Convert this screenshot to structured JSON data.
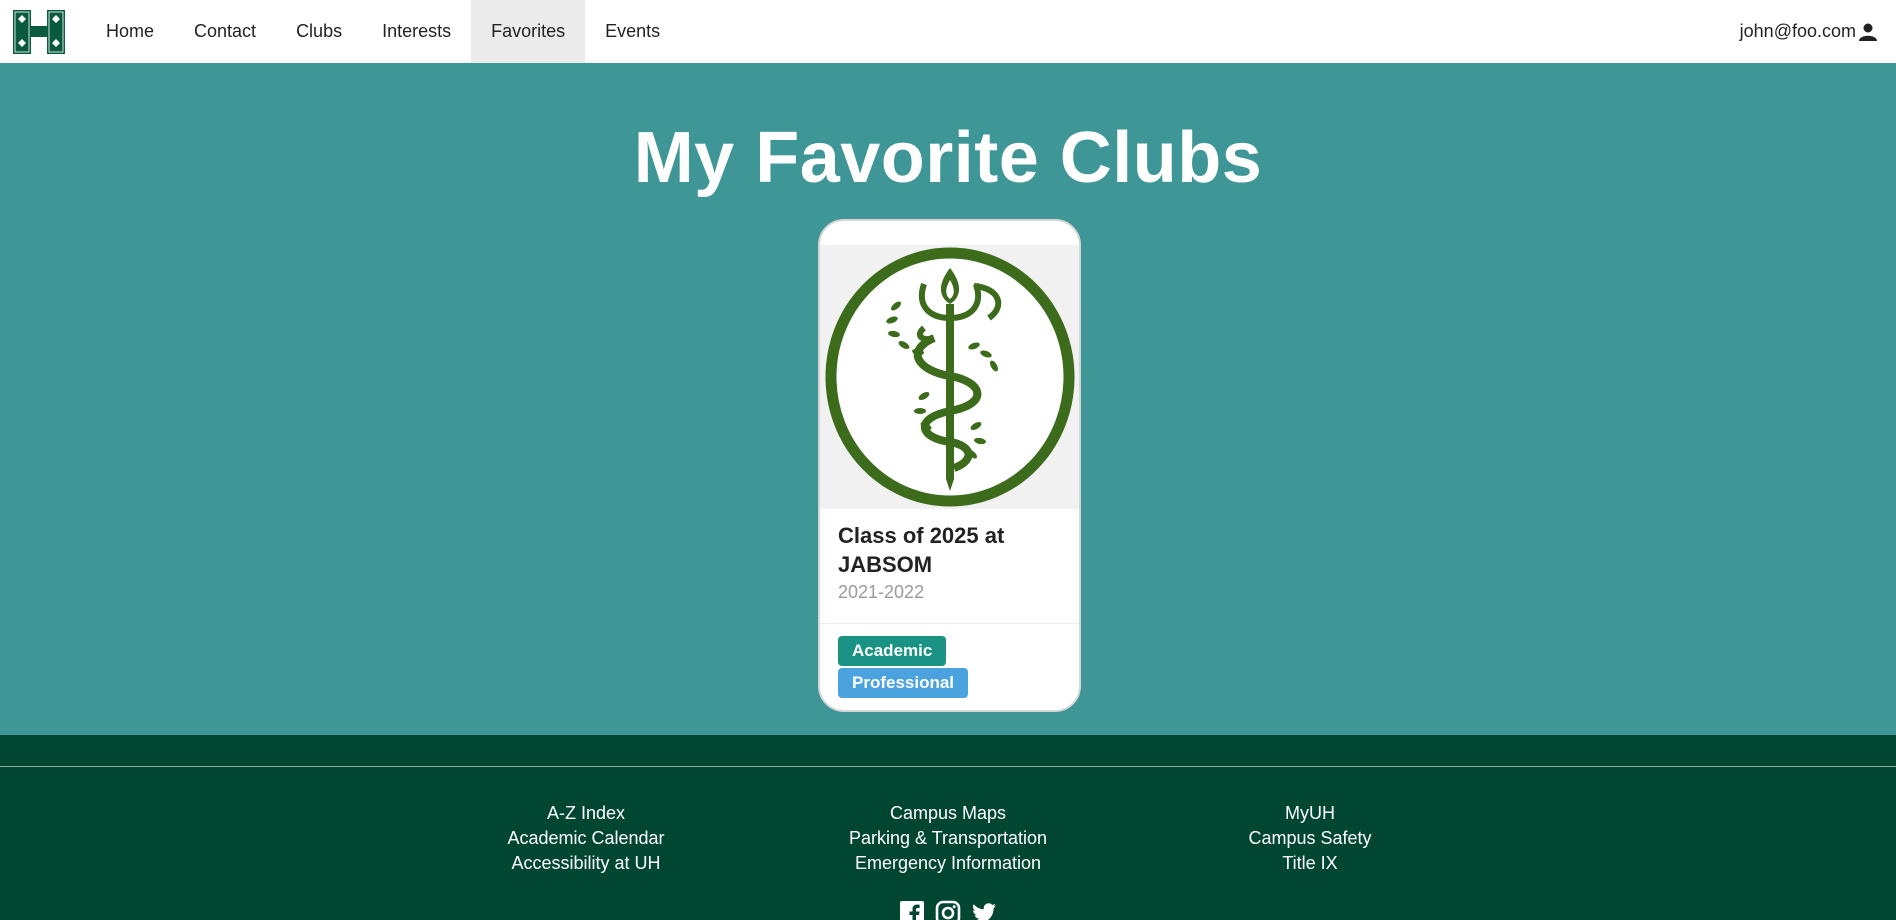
{
  "nav": {
    "items": [
      {
        "label": "Home"
      },
      {
        "label": "Contact"
      },
      {
        "label": "Clubs"
      },
      {
        "label": "Interests"
      },
      {
        "label": "Favorites",
        "active": true
      },
      {
        "label": "Events"
      }
    ],
    "user_email": "john@foo.com"
  },
  "page": {
    "title": "My Favorite Clubs"
  },
  "club_card": {
    "name": "Class of 2025 at JABSOM",
    "years": "2021-2022",
    "tags": [
      "Academic",
      "Professional"
    ]
  },
  "footer": {
    "columns": [
      [
        "A-Z Index",
        "Academic Calendar",
        "Accessibility at UH"
      ],
      [
        "Campus Maps",
        "Parking & Transportation",
        "Emergency Information"
      ],
      [
        "MyUH",
        "Campus Safety",
        "Title IX"
      ]
    ],
    "social_icons": [
      "facebook-icon",
      "instagram-icon",
      "twitter-icon"
    ]
  },
  "colors": {
    "main_bg": "#3f9696",
    "footer_bg": "#004631",
    "tag_academic": "#1a9384",
    "tag_professional": "#4aa3df",
    "logo_green": "#0a5a3f",
    "emblem_green": "#3d6b1c"
  }
}
